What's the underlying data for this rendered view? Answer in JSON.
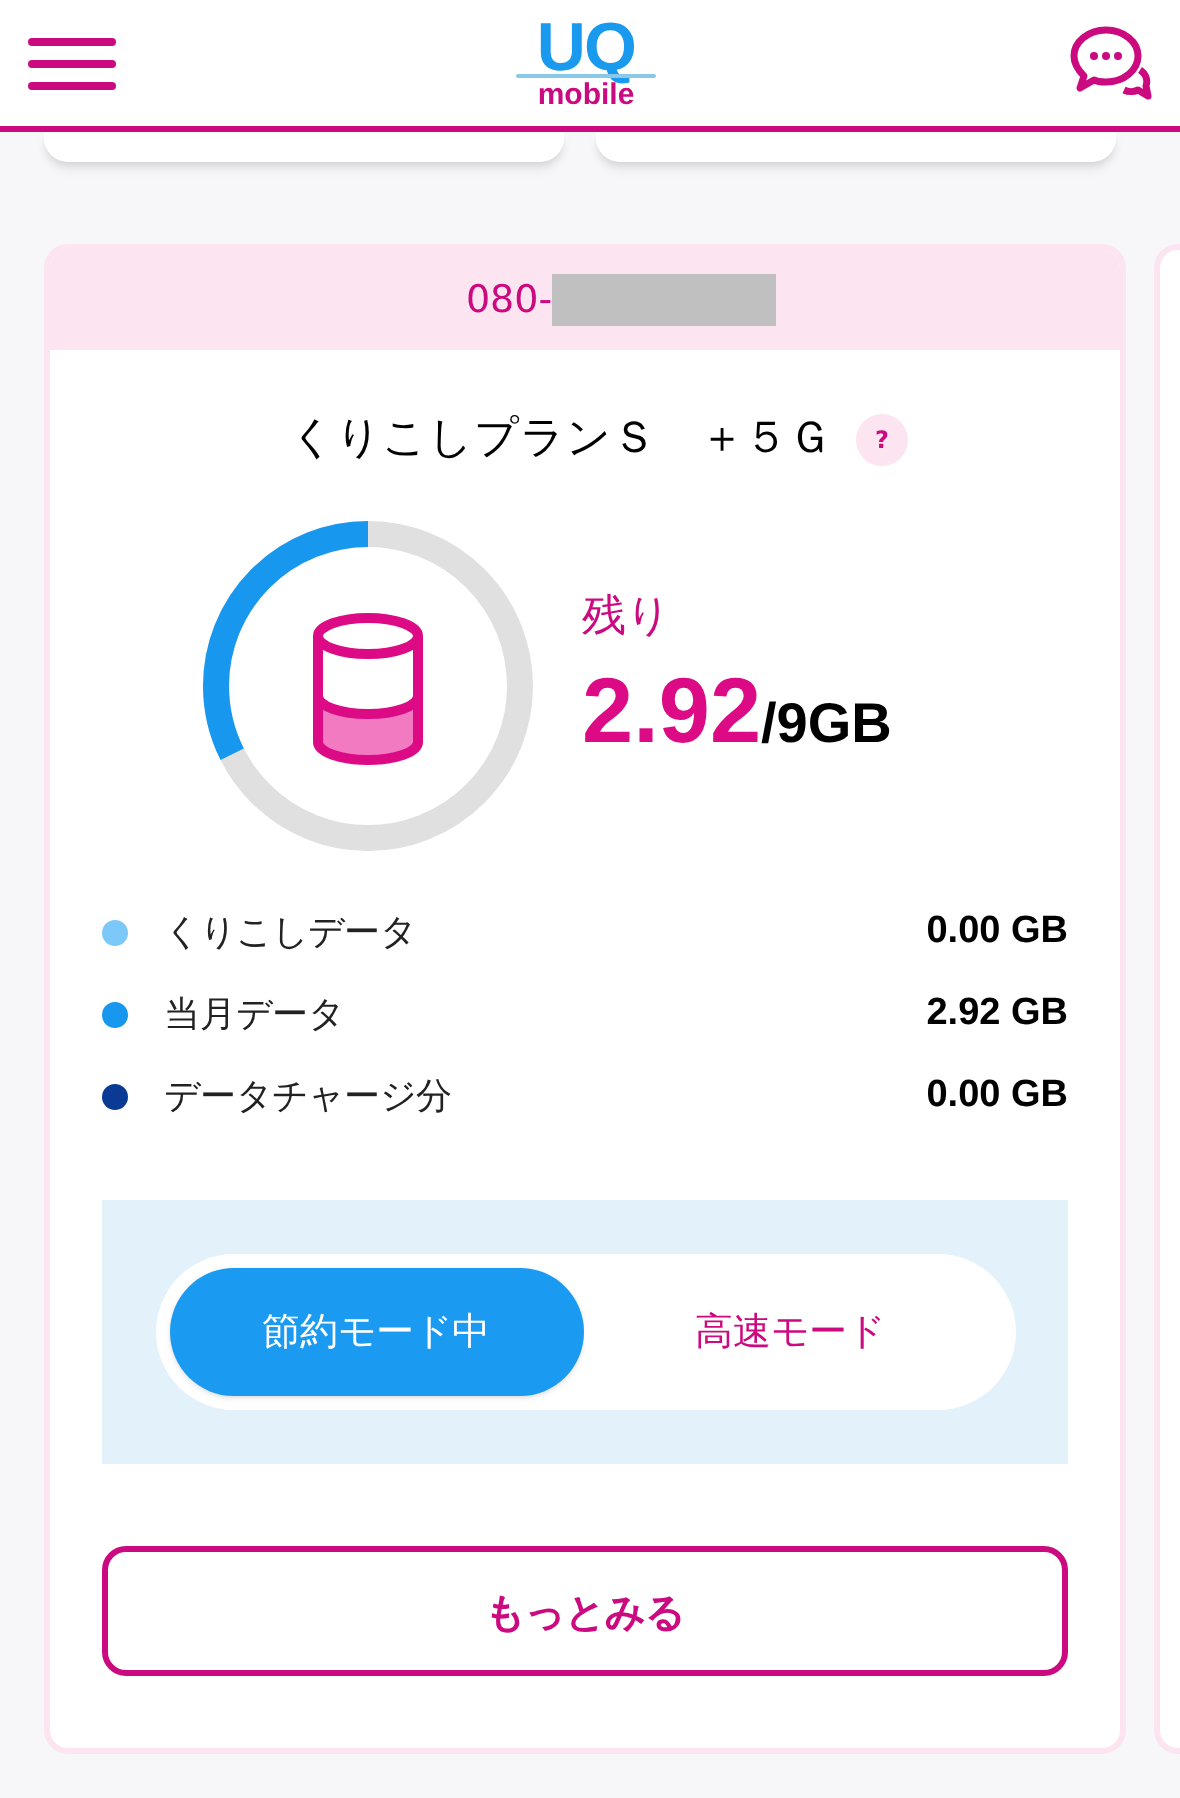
{
  "header": {
    "logo": {
      "main": "UQ",
      "sub": "mobile"
    }
  },
  "card": {
    "phone_prefix": "080-",
    "plan": "くりこしプランＳ　＋５Ｇ",
    "help": "?",
    "gauge": {
      "level": 0.324
    },
    "remaining_label": "残り",
    "remaining_value": "2.92",
    "remaining_total": "/9GB",
    "breakdown": [
      {
        "label": "くりこしデータ",
        "value": "0.00 GB",
        "color": "#7cc8f8"
      },
      {
        "label": "当月データ",
        "value": "2.92 GB",
        "color": "#1797ee"
      },
      {
        "label": "データチャージ分",
        "value": "0.00 GB",
        "color": "#0b3a94"
      }
    ],
    "modes": [
      {
        "label": "節約モード中",
        "selected": true
      },
      {
        "label": "高速モード",
        "selected": false
      }
    ],
    "more_button": "もっとみる"
  }
}
